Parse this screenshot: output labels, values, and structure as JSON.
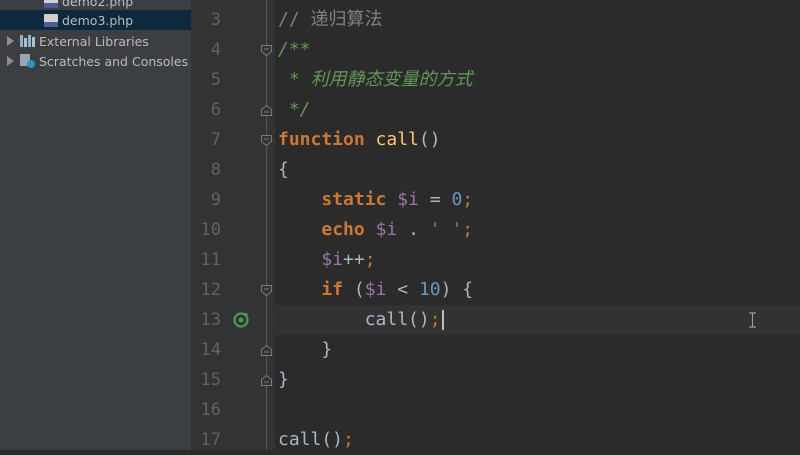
{
  "project_tree": {
    "items": [
      {
        "label": "demo2.php",
        "icon": "php-file-icon"
      },
      {
        "label": "demo3.php",
        "icon": "php-file-icon",
        "selected": true
      },
      {
        "label": "External Libraries",
        "icon": "libraries-icon"
      },
      {
        "label": "Scratches and Consoles",
        "icon": "scratches-icon"
      }
    ]
  },
  "gutter": {
    "line_numbers": [
      "3",
      "4",
      "5",
      "6",
      "7",
      "8",
      "9",
      "10",
      "11",
      "12",
      "13",
      "14",
      "15",
      "16",
      "17"
    ]
  },
  "editor": {
    "current_line": 13,
    "lines": [
      {
        "n": 3,
        "tokens": [
          [
            "comment",
            "// 递归算法"
          ]
        ]
      },
      {
        "n": 4,
        "tokens": [
          [
            "doc",
            "/**"
          ]
        ]
      },
      {
        "n": 5,
        "tokens": [
          [
            "doc",
            " * 利用静态变量的方式"
          ]
        ]
      },
      {
        "n": 6,
        "tokens": [
          [
            "doc",
            " */"
          ]
        ]
      },
      {
        "n": 7,
        "tokens": [
          [
            "kw",
            "function"
          ],
          [
            "punct",
            " "
          ],
          [
            "fn",
            "call"
          ],
          [
            "punct",
            "()"
          ]
        ]
      },
      {
        "n": 8,
        "tokens": [
          [
            "punct",
            "{"
          ]
        ]
      },
      {
        "n": 9,
        "tokens": [
          [
            "punct",
            "    "
          ],
          [
            "kw",
            "static"
          ],
          [
            "punct",
            " "
          ],
          [
            "var",
            "$i"
          ],
          [
            "punct",
            " = "
          ],
          [
            "num",
            "0"
          ],
          [
            "semi",
            ";"
          ]
        ]
      },
      {
        "n": 10,
        "tokens": [
          [
            "punct",
            "    "
          ],
          [
            "kw",
            "echo"
          ],
          [
            "punct",
            " "
          ],
          [
            "var",
            "$i"
          ],
          [
            "punct",
            " . "
          ],
          [
            "str",
            "' '"
          ],
          [
            "semi",
            ";"
          ]
        ]
      },
      {
        "n": 11,
        "tokens": [
          [
            "punct",
            "    "
          ],
          [
            "var",
            "$i"
          ],
          [
            "punct",
            "++"
          ],
          [
            "semi",
            ";"
          ]
        ]
      },
      {
        "n": 12,
        "tokens": [
          [
            "punct",
            "    "
          ],
          [
            "kw",
            "if"
          ],
          [
            "punct",
            " ("
          ],
          [
            "var",
            "$i"
          ],
          [
            "punct",
            " < "
          ],
          [
            "num",
            "10"
          ],
          [
            "punct",
            ") {"
          ]
        ]
      },
      {
        "n": 13,
        "tokens": [
          [
            "punct",
            "        "
          ],
          [
            "punct",
            "call()"
          ],
          [
            "semi",
            ";"
          ]
        ]
      },
      {
        "n": 14,
        "tokens": [
          [
            "punct",
            "    }"
          ]
        ]
      },
      {
        "n": 15,
        "tokens": [
          [
            "punct",
            "}"
          ]
        ]
      },
      {
        "n": 16,
        "tokens": []
      },
      {
        "n": 17,
        "tokens": [
          [
            "punct",
            "call()"
          ],
          [
            "semi",
            ";"
          ]
        ]
      }
    ]
  },
  "colors": {
    "keyword": "#cc7832",
    "function": "#ffc66d",
    "variable": "#9876aa",
    "number": "#6897bb",
    "string": "#6a8759",
    "doc_comment": "#629755",
    "line_comment": "#808080",
    "editor_bg": "#2b2b2b",
    "gutter_bg": "#313335",
    "sidebar_bg": "#3c3f41"
  }
}
